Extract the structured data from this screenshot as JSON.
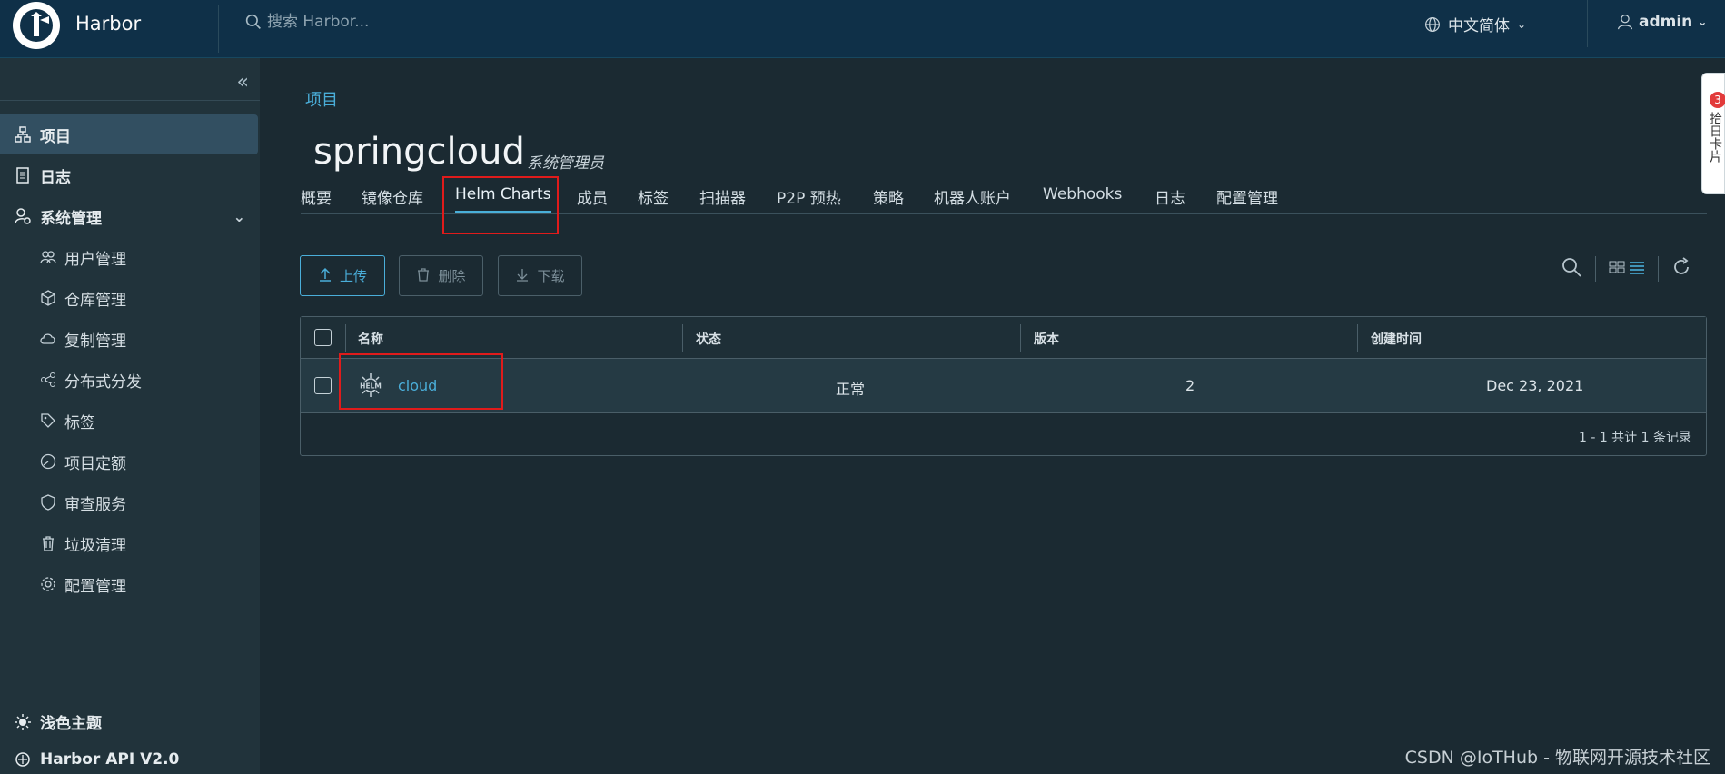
{
  "header": {
    "brand": "Harbor",
    "search_placeholder": "搜索 Harbor...",
    "language": "中文简体",
    "user": "admin"
  },
  "sidebar": {
    "items": [
      {
        "label": "项目",
        "icon": "projects-icon",
        "active": true
      },
      {
        "label": "日志",
        "icon": "logs-icon"
      },
      {
        "label": "系统管理",
        "icon": "admin-icon",
        "expanded": true
      }
    ],
    "sub_items": [
      {
        "label": "用户管理",
        "icon": "users-icon"
      },
      {
        "label": "仓库管理",
        "icon": "registry-icon"
      },
      {
        "label": "复制管理",
        "icon": "replication-icon"
      },
      {
        "label": "分布式分发",
        "icon": "distribution-icon"
      },
      {
        "label": "标签",
        "icon": "tag-icon"
      },
      {
        "label": "项目定额",
        "icon": "quota-icon"
      },
      {
        "label": "审查服务",
        "icon": "shield-icon"
      },
      {
        "label": "垃圾清理",
        "icon": "trash-icon"
      },
      {
        "label": "配置管理",
        "icon": "gear-icon"
      }
    ],
    "theme_label": "浅色主题",
    "api_label": "Harbor API V2.0"
  },
  "main": {
    "breadcrumb": "项目",
    "project_name": "springcloud",
    "project_role": "系统管理员",
    "tabs": [
      "概要",
      "镜像仓库",
      "Helm Charts",
      "成员",
      "标签",
      "扫描器",
      "P2P 预热",
      "策略",
      "机器人账户",
      "Webhooks",
      "日志",
      "配置管理"
    ],
    "active_tab": "Helm Charts",
    "buttons": {
      "upload": "上传",
      "delete": "删除",
      "download": "下载"
    },
    "table": {
      "columns": [
        "名称",
        "状态",
        "版本",
        "创建时间"
      ],
      "rows": [
        {
          "icon_text": "HELM",
          "name": "cloud",
          "status": "正常",
          "version": "2",
          "created": "Dec 23, 2021"
        }
      ],
      "footer": "1 - 1 共计 1 条记录"
    }
  },
  "feedback": {
    "badge": "3",
    "label": "拾日卡片"
  },
  "watermark": "CSDN @IoTHub - 物联网开源技术社区",
  "colors": {
    "accent": "#4aaed9",
    "header_bg": "#0f3048",
    "sidebar_bg": "#21333b",
    "highlight": "#e01b1b"
  }
}
